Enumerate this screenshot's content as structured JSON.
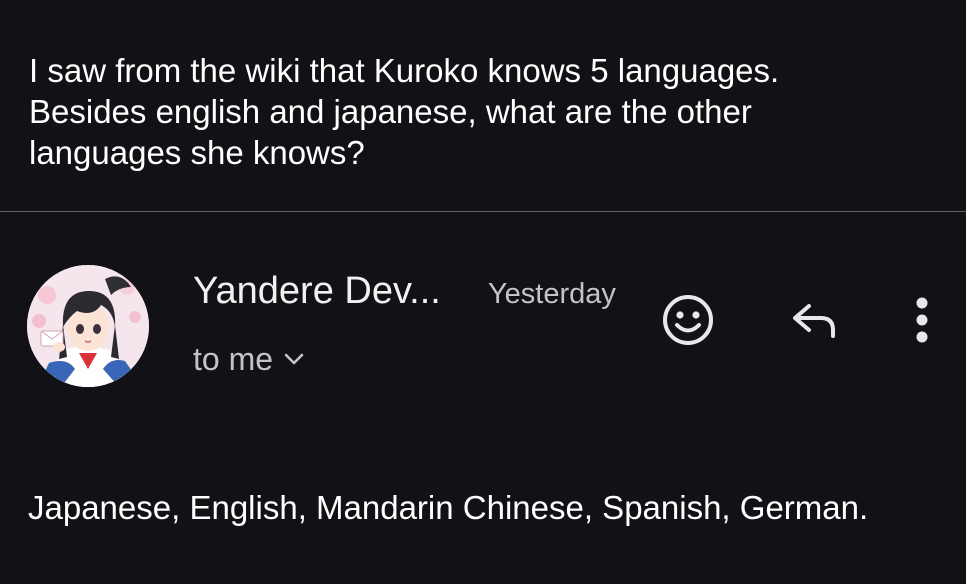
{
  "previous_message": {
    "text": "I saw from the wiki that Kuroko knows 5 languages.\nBesides english and japanese, what are the other\nlanguages she knows?"
  },
  "reply": {
    "sender": "Yandere Dev...",
    "timestamp": "Yesterday",
    "recipient": "to me",
    "body": "Japanese, English, Mandarin Chinese, Spanish, German."
  },
  "icons": {
    "avatar": "anime-girl-avatar",
    "recipient_toggle": "chevron-down-icon",
    "emoji": "smiley-icon",
    "reply": "reply-arrow-icon",
    "more": "more-vertical-icon"
  },
  "colors": {
    "background": "#121216",
    "divider": "#5e5e63",
    "primary_text": "#ffffff",
    "secondary_text": "#c4c4c8"
  }
}
